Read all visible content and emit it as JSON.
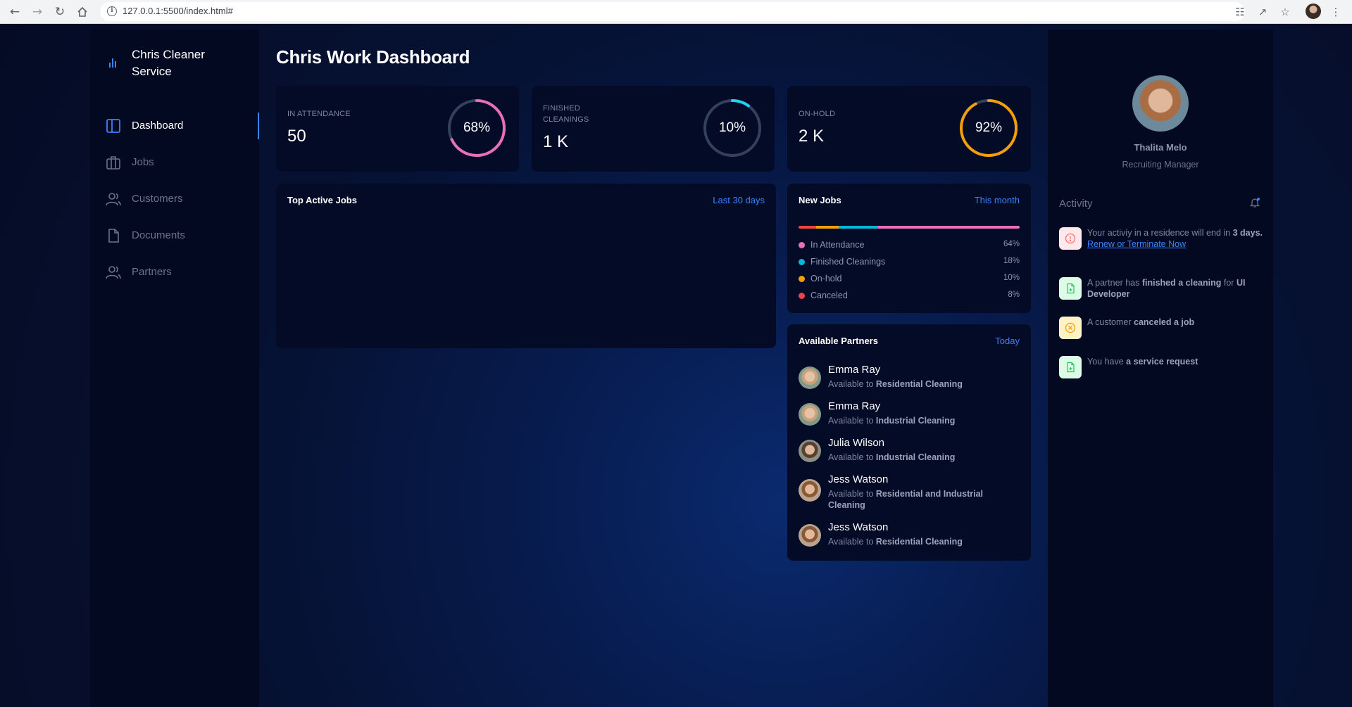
{
  "browser": {
    "url": "127.0.0.1:5500/index.html#"
  },
  "sidebar": {
    "brand": "Chris Cleaner Service",
    "items": [
      {
        "label": "Dashboard",
        "icon": "columns-icon",
        "active": true
      },
      {
        "label": "Jobs",
        "icon": "briefcase-icon",
        "active": false
      },
      {
        "label": "Customers",
        "icon": "users-icon",
        "active": false
      },
      {
        "label": "Documents",
        "icon": "document-icon",
        "active": false
      },
      {
        "label": "Partners",
        "icon": "users-icon",
        "active": false
      }
    ]
  },
  "main": {
    "title": "Chris Work Dashboard",
    "stats": [
      {
        "label": "IN ATTENDANCE",
        "value": "50",
        "percent": 68,
        "percent_label": "68%",
        "color": "#e86fb8"
      },
      {
        "label": "FINISHED CLEANINGS",
        "value": "1 K",
        "percent": 10,
        "percent_label": "10%",
        "color": "#22d3ee"
      },
      {
        "label": "ON-HOLD",
        "value": "2 K",
        "percent": 92,
        "percent_label": "92%",
        "color": "#f59e0b"
      }
    ],
    "top_jobs": {
      "title": "Top Active Jobs",
      "period": "Last 30 days"
    },
    "new_jobs": {
      "title": "New Jobs",
      "period": "This month",
      "items": [
        {
          "name": "In Attendance",
          "percent_label": "64%",
          "percent": 64,
          "color": "#e86fb8"
        },
        {
          "name": "Finished Cleanings",
          "percent_label": "18%",
          "percent": 18,
          "color": "#06b6d4"
        },
        {
          "name": "On-hold",
          "percent_label": "10%",
          "percent": 10,
          "color": "#f59e0b"
        },
        {
          "name": "Canceled",
          "percent_label": "8%",
          "percent": 8,
          "color": "#ef4444"
        }
      ]
    },
    "partners": {
      "title": "Available Partners",
      "period": "Today",
      "prefix": "Available to",
      "items": [
        {
          "name": "Emma Ray",
          "service": "Residential Cleaning"
        },
        {
          "name": "Emma Ray",
          "service": "Industrial Cleaning"
        },
        {
          "name": "Julia Wilson",
          "service": "Industrial Cleaning"
        },
        {
          "name": "Jess Watson",
          "service": "Residential and Industrial Cleaning"
        },
        {
          "name": "Jess Watson",
          "service": "Residential Cleaning"
        }
      ]
    }
  },
  "profile": {
    "name": "Thalita Melo",
    "role": "Recruiting Manager"
  },
  "activity": {
    "title": "Activity",
    "items": [
      {
        "pre": "Your activiy in a residence will end in",
        "bold": "3 days.",
        "link": "Renew or Terminate Now",
        "icon": "alert-icon",
        "color": "#f87171",
        "bg": "#fde8ec"
      },
      {
        "pre": "A partner has",
        "bold": "finished a cleaning",
        "post": "for",
        "bold2": "UI Developer",
        "icon": "file-icon",
        "color": "#22c55e",
        "bg": "#dcfce7"
      },
      {
        "pre": "A customer",
        "bold": "canceled a job",
        "icon": "x-circle-icon",
        "color": "#f59e0b",
        "bg": "#fef3c7"
      },
      {
        "pre": "You have",
        "bold": "a service request",
        "icon": "file-icon",
        "color": "#22c55e",
        "bg": "#dcfce7"
      }
    ]
  }
}
